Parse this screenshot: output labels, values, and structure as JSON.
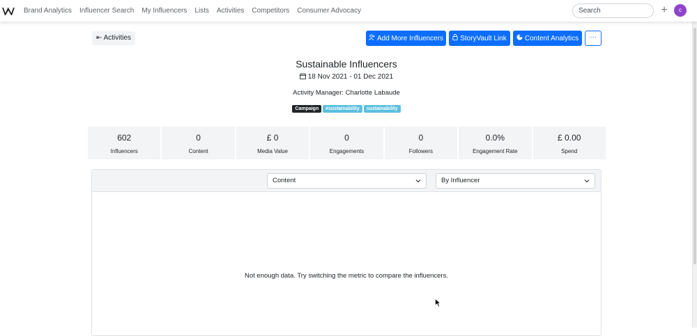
{
  "nav": {
    "links": [
      "Brand Analytics",
      "Influencer Search",
      "My Influencers",
      "Lists",
      "Activities",
      "Competitors",
      "Consumer Advocacy"
    ],
    "search_placeholder": "Search",
    "plus_label": "+",
    "avatar_initial": "c"
  },
  "toolbar": {
    "back_label": "Activities",
    "add_influencers_label": "Add More Influencers",
    "storyvault_label": "StoryVault Link",
    "content_analytics_label": "Content Analytics",
    "more_label": "···"
  },
  "activity": {
    "title": "Sustainable Influencers",
    "date_range": "18 Nov 2021 - 01 Dec 2021",
    "manager_label": "Activity Manager:",
    "manager_name": "Charlotte Labaude",
    "badges": [
      "Campaign",
      "#sustainability",
      "sustainability"
    ]
  },
  "stats": [
    {
      "value": "602",
      "label": "Influencers"
    },
    {
      "value": "0",
      "label": "Content"
    },
    {
      "value": "£ 0",
      "label": "Media Value"
    },
    {
      "value": "0",
      "label": "Engagements"
    },
    {
      "value": "0",
      "label": "Followers"
    },
    {
      "value": "0.0%",
      "label": "Engagement Rate"
    },
    {
      "value": "£ 0.00",
      "label": "Spend"
    }
  ],
  "panel": {
    "metric_select": "Content",
    "group_select": "By Influencer",
    "empty_message": "Not enough data. Try switching the metric to compare the influencers."
  },
  "colors": {
    "primary": "#0d6efd",
    "avatar": "#8e44c9",
    "badge_dark": "#212529",
    "badge_info": "#5bc0de"
  }
}
